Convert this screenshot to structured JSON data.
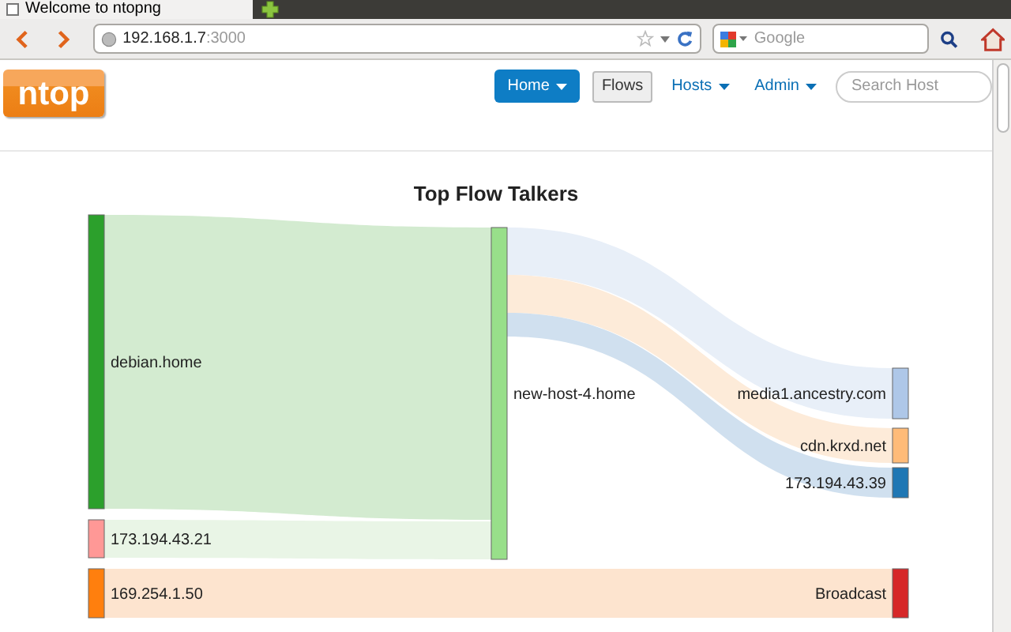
{
  "browser": {
    "tabs": [
      {
        "title": "Welcome to ntopng",
        "selected": true
      }
    ],
    "address": {
      "host": "192.168.1.7",
      "port": ":3000"
    },
    "search_engine": {
      "placeholder": "Google"
    }
  },
  "navbar": {
    "logo": "ntop",
    "items": [
      {
        "label": "Home",
        "kind": "button",
        "dropdown": true,
        "selected": true
      },
      {
        "label": "Flows",
        "kind": "button",
        "dropdown": false,
        "selected": false
      },
      {
        "label": "Hosts",
        "kind": "link",
        "dropdown": true,
        "selected": false
      },
      {
        "label": "Admin",
        "kind": "link",
        "dropdown": true,
        "selected": false
      }
    ],
    "search": {
      "placeholder": "Search Host"
    }
  },
  "flow_diagram": {
    "title": "Top Flow Talkers",
    "nodes": [
      {
        "name": "debian.home",
        "color": "#2ca02c"
      },
      {
        "name": "173.194.43.21",
        "color": "#ff9896"
      },
      {
        "name": "169.254.1.50",
        "color": "#ff7f0e"
      },
      {
        "name": "new-host-4.home",
        "color": "#98df8a"
      },
      {
        "name": "media1.ancestry.com",
        "color": "#aec7e8"
      },
      {
        "name": "cdn.krxd.net",
        "color": "#ffbb78"
      },
      {
        "name": "173.194.43.39",
        "color": "#1f77b4"
      },
      {
        "name": "Broadcast",
        "color": "#d62728"
      }
    ],
    "links": [
      {
        "color": "#d3ebd0"
      },
      {
        "color": "#e9f5e6"
      },
      {
        "color": "#e8eff8"
      },
      {
        "color": "#fdebd9"
      },
      {
        "color": "#d0e0ef"
      },
      {
        "color": "#fde4cf"
      }
    ]
  }
}
